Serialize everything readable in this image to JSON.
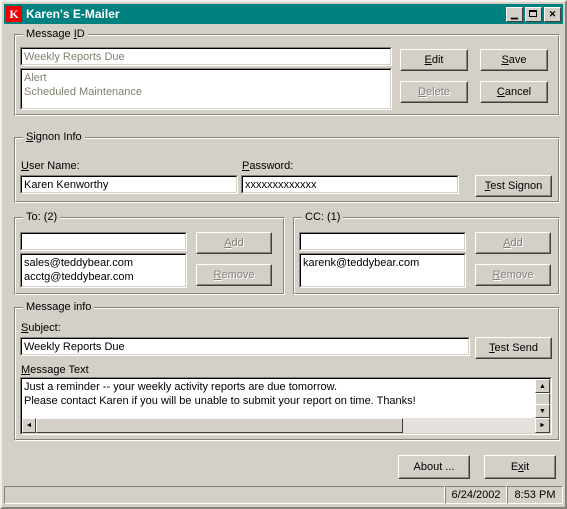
{
  "window": {
    "title": "Karen's E-Mailer",
    "icon_letter": "K",
    "icon_color": "#ee0000",
    "titlebar_color": "#00807f",
    "face_color": "#d4d0c8",
    "controls": {
      "minimize": "_",
      "maximize": "□",
      "close": "✕"
    }
  },
  "message_id": {
    "group_label_pre": "Message ",
    "group_label_accel": "I",
    "group_label_post": "D",
    "combo_value": "Weekly Reports Due",
    "list_items": [
      "Alert",
      "Scheduled Maintenance"
    ],
    "buttons": [
      {
        "pre": "",
        "accel": "E",
        "post": "dit",
        "enabled": true
      },
      {
        "pre": "",
        "accel": "S",
        "post": "ave",
        "enabled": true
      },
      {
        "pre": "",
        "accel": "D",
        "post": "elete",
        "enabled": false
      },
      {
        "pre": "",
        "accel": "C",
        "post": "ancel",
        "enabled": true
      }
    ]
  },
  "signon": {
    "group_label_pre": "",
    "group_label_accel": "S",
    "group_label_post": "ignon Info",
    "username_label_accel": "U",
    "username_label_post": "ser Name:",
    "username_value": "Karen Kenworthy",
    "password_label_accel": "P",
    "password_label_post": "assword:",
    "password_value": "xxxxxxxxxxxxx",
    "test_signon_accel": "T",
    "test_signon_post": "est Signon"
  },
  "to": {
    "group_label": "To: (2)",
    "input_value": "",
    "recipients": [
      "sales@teddybear.com",
      "acctg@teddybear.com"
    ],
    "add_accel": "A",
    "add_post": "dd",
    "add_enabled": false,
    "remove_accel": "R",
    "remove_post": "emove",
    "remove_enabled": false
  },
  "cc": {
    "group_label": "CC: (1)",
    "input_value": "",
    "recipients": [
      "karenk@teddybear.com"
    ],
    "add_accel": "A",
    "add_post": "dd",
    "add_enabled": false,
    "remove_accel": "R",
    "remove_post": "emove",
    "remove_enabled": false
  },
  "message_info": {
    "group_label": "Message info",
    "subject_label_accel": "S",
    "subject_label_post": "ubject:",
    "subject_value": "Weekly Reports Due",
    "test_send_accel": "T",
    "test_send_post": "est Send",
    "message_text_label_accel": "M",
    "message_text_label_post": "essage Text",
    "message_text_lines": [
      "Just a reminder -- your weekly activity reports are due tomorrow.",
      "Please contact Karen if you will be unable to submit your report on time.  Thanks!"
    ]
  },
  "footer": {
    "about_label": "About ...",
    "exit_pre": "E",
    "exit_accel": "x",
    "exit_post": "it"
  },
  "statusbar": {
    "message": "",
    "date": "6/24/2002",
    "time": "8:53 PM"
  },
  "scroll_glyphs": {
    "up": "▲",
    "down": "▼",
    "left": "◄",
    "right": "►"
  }
}
